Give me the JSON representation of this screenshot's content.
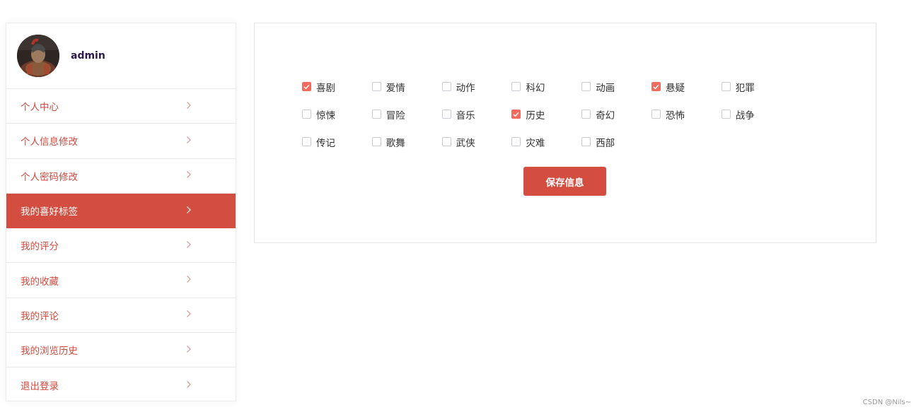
{
  "user": {
    "name": "admin"
  },
  "menu": [
    {
      "label": "个人中心",
      "active": false
    },
    {
      "label": "个人信息修改",
      "active": false
    },
    {
      "label": "个人密码修改",
      "active": false
    },
    {
      "label": "我的喜好标签",
      "active": true
    },
    {
      "label": "我的评分",
      "active": false
    },
    {
      "label": "我的收藏",
      "active": false
    },
    {
      "label": "我的评论",
      "active": false
    },
    {
      "label": "我的浏览历史",
      "active": false
    },
    {
      "label": "退出登录",
      "active": false
    }
  ],
  "chevron_icon": "chevron-right-icon",
  "tags": [
    {
      "label": "喜剧",
      "checked": true
    },
    {
      "label": "爱情",
      "checked": false
    },
    {
      "label": "动作",
      "checked": false
    },
    {
      "label": "科幻",
      "checked": false
    },
    {
      "label": "动画",
      "checked": false
    },
    {
      "label": "悬疑",
      "checked": true
    },
    {
      "label": "犯罪",
      "checked": false
    },
    {
      "label": "惊悚",
      "checked": false
    },
    {
      "label": "冒险",
      "checked": false
    },
    {
      "label": "音乐",
      "checked": false
    },
    {
      "label": "历史",
      "checked": true
    },
    {
      "label": "奇幻",
      "checked": false
    },
    {
      "label": "恐怖",
      "checked": false
    },
    {
      "label": "战争",
      "checked": false
    },
    {
      "label": "传记",
      "checked": false
    },
    {
      "label": "歌舞",
      "checked": false
    },
    {
      "label": "武侠",
      "checked": false
    },
    {
      "label": "灾难",
      "checked": false
    },
    {
      "label": "西部",
      "checked": false
    }
  ],
  "save_button": {
    "label": "保存信息"
  },
  "watermark": "CSDN @Nils~",
  "colors": {
    "accent": "#d34e40",
    "checkbox_checked": "#f36b5e",
    "menu_text": "#d04a3e",
    "username": "#2c1a4e"
  }
}
